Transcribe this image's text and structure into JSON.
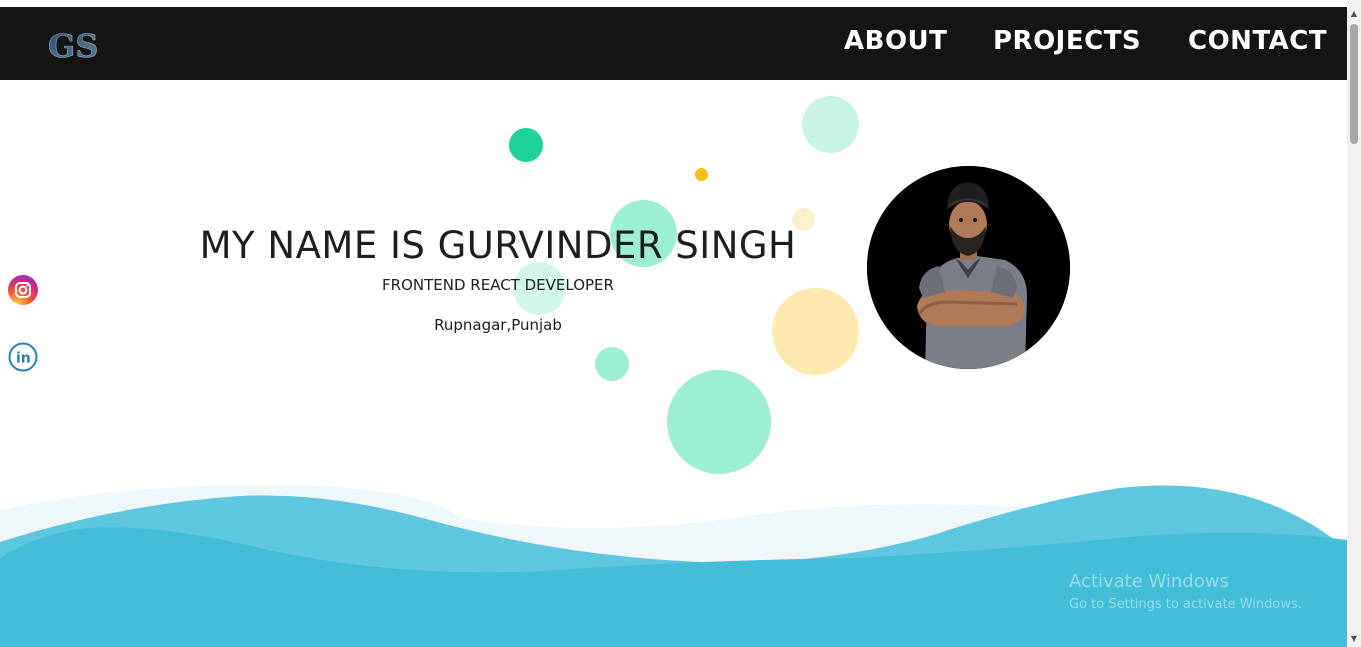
{
  "header": {
    "logo_text": "GS",
    "nav": [
      {
        "label": "ABOUT"
      },
      {
        "label": "PROJECTS"
      },
      {
        "label": "CONTACT"
      }
    ]
  },
  "hero": {
    "title": "MY NAME IS GURVINDER SINGH",
    "role": "FRONTEND REACT DEVELOPER",
    "location": "Rupnagar,Punjab"
  },
  "social": [
    {
      "icon": "instagram-icon"
    },
    {
      "icon": "linkedin-icon"
    }
  ],
  "watermark": {
    "title": "Activate Windows",
    "subtitle": "Go to Settings to activate Windows."
  },
  "colors": {
    "navbar": "#141414",
    "wave": "#43bdd8",
    "bubble_green": "#1ed39a",
    "bubble_yellow": "#f6c119"
  }
}
